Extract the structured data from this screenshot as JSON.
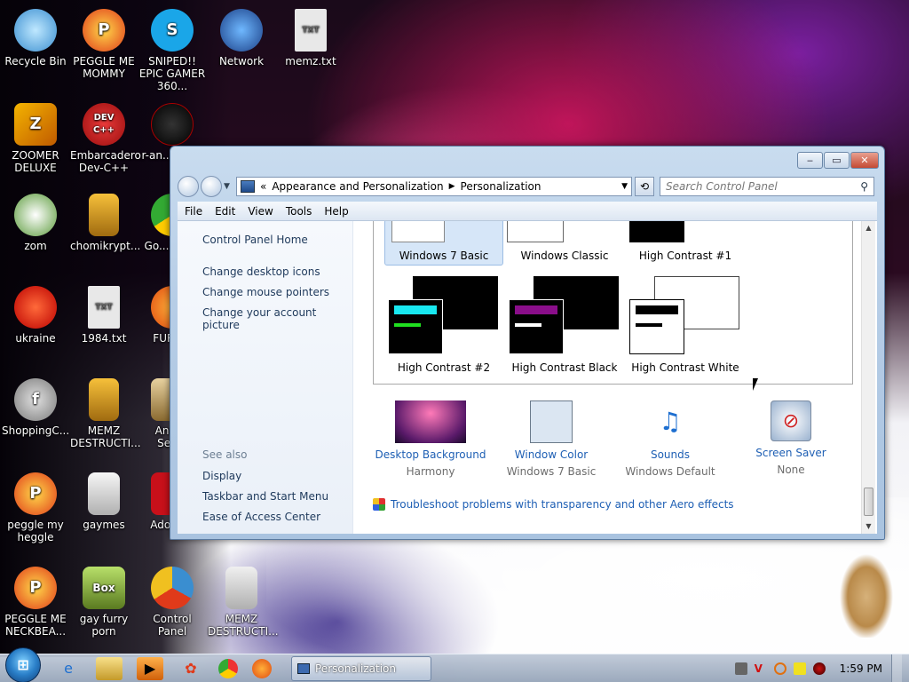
{
  "desktop": {
    "icons": [
      {
        "label": "Recycle Bin"
      },
      {
        "label": "PEGGLE ME MOMMY"
      },
      {
        "label": "SNIPED!! EPIC GAMER 360..."
      },
      {
        "label": "Network"
      },
      {
        "label": "memz.txt"
      },
      {
        "label": "ZOOMER DELUXE"
      },
      {
        "label": "Embarcadero Dev-C++"
      },
      {
        "label": "r-an... par..."
      },
      {
        "label": "zom"
      },
      {
        "label": "chomikrypt..."
      },
      {
        "label": "Go... Chr..."
      },
      {
        "label": "ukraine"
      },
      {
        "label": "1984.txt"
      },
      {
        "label": "FURR..."
      },
      {
        "label": "ShoppingC..."
      },
      {
        "label": "MEMZ DESTRUCTI..."
      },
      {
        "label": "Angr... Sea..."
      },
      {
        "label": "peggle my heggle"
      },
      {
        "label": "gaymes"
      },
      {
        "label": "Adobe..."
      },
      {
        "label": "PEGGLE ME NECKBEA..."
      },
      {
        "label": "gay furry porn"
      },
      {
        "label": "Control Panel"
      },
      {
        "label": "MEMZ DESTRUCTI..."
      }
    ],
    "icon_badges": {
      "dev": "DEV C++",
      "box": "Box",
      "txt": "TXT"
    }
  },
  "window": {
    "address": {
      "chevrons": "«",
      "crumb1": "Appearance and Personalization",
      "crumb2": "Personalization"
    },
    "search_placeholder": "Search Control Panel",
    "menu": [
      "File",
      "Edit",
      "View",
      "Tools",
      "Help"
    ],
    "left": {
      "home": "Control Panel Home",
      "links": [
        "Change desktop icons",
        "Change mouse pointers",
        "Change your account picture"
      ],
      "see_also": "See also",
      "see_links": [
        "Display",
        "Taskbar and Start Menu",
        "Ease of Access Center"
      ]
    },
    "themes": [
      {
        "name": "Windows 7 Basic",
        "selected": true
      },
      {
        "name": "Windows Classic",
        "selected": false
      },
      {
        "name": "High Contrast #1",
        "selected": false
      },
      {
        "name": "High Contrast #2",
        "selected": false
      },
      {
        "name": "High Contrast Black",
        "selected": false
      },
      {
        "name": "High Contrast White",
        "selected": false
      }
    ],
    "bottom": [
      {
        "title": "Desktop Background",
        "sub": "Harmony"
      },
      {
        "title": "Window Color",
        "sub": "Windows 7 Basic"
      },
      {
        "title": "Sounds",
        "sub": "Windows Default"
      },
      {
        "title": "Screen Saver",
        "sub": "None"
      }
    ],
    "troubleshoot": "Troubleshoot problems with transparency and other Aero effects"
  },
  "taskbar": {
    "task_label": "Personalization",
    "clock": "1:59 PM"
  },
  "colors": {
    "link": "#1e5fb4",
    "accent": "#2a7fc8"
  }
}
